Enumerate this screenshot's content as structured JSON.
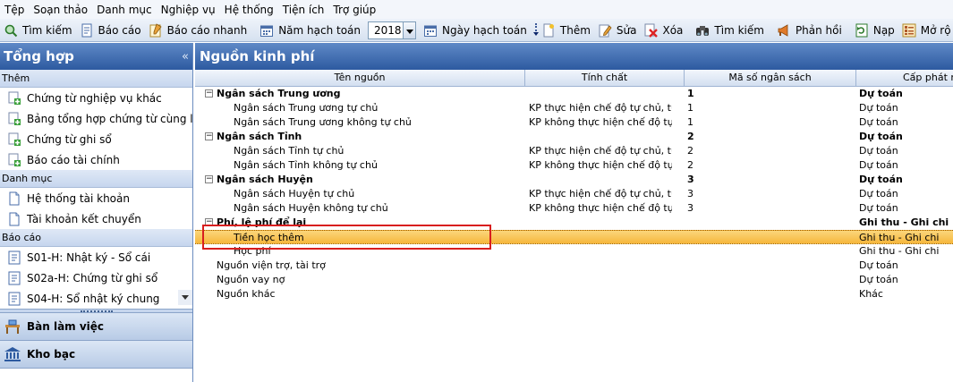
{
  "menu": [
    "Tệp",
    "Soạn thảo",
    "Danh mục",
    "Nghiệp vụ",
    "Hệ thống",
    "Tiện ích",
    "Trợ giúp"
  ],
  "toolbar": {
    "search": "Tìm kiếm",
    "report": "Báo cáo",
    "quick_report": "Báo cáo nhanh",
    "fiscal_year_label": "Năm hạch toán",
    "fiscal_year_value": "2018",
    "posting_date": "Ngày hạch toán",
    "add": "Thêm",
    "edit": "Sửa",
    "delete": "Xóa",
    "search2": "Tìm kiếm",
    "feedback": "Phản hồi",
    "load": "Nạp",
    "open": "Mở rộ"
  },
  "left": {
    "title": "Tổng hợp",
    "collapse": "«",
    "groups": [
      {
        "label": "Thêm",
        "items": [
          "Chứng từ nghiệp vụ khác",
          "Bảng tổng hợp chứng từ cùng loại",
          "Chứng từ ghi sổ",
          "Báo cáo tài chính"
        ]
      },
      {
        "label": "Danh mục",
        "items": [
          "Hệ thống tài khoản",
          "Tài khoản kết chuyển"
        ]
      },
      {
        "label": "Báo cáo",
        "items": [
          "S01-H: Nhật ký - Sổ cái",
          "S02a-H: Chứng từ ghi sổ",
          "S04-H: Sổ nhật ký chung"
        ]
      }
    ],
    "nav": [
      "Bàn làm việc",
      "Kho bạc"
    ]
  },
  "right": {
    "title": "Nguồn kinh phí",
    "columns": [
      "Tên nguồn",
      "Tính chất",
      "Mã số ngân sách",
      "Cấp phát n"
    ],
    "rows": [
      {
        "name": "Ngân sách Trung ương",
        "nature": "",
        "code": "1",
        "alloc": "Dự toán",
        "level": 0,
        "bold": true,
        "group": true
      },
      {
        "name": "Ngân sách Trung ương tự chủ",
        "nature": "KP thực hiện chế độ tự chủ, tự...",
        "code": "1",
        "alloc": "Dự toán",
        "level": 1
      },
      {
        "name": "Ngân sách Trung ương không tự chủ",
        "nature": "KP không thực hiện chế độ tự...",
        "code": "1",
        "alloc": "Dự toán",
        "level": 1
      },
      {
        "name": "Ngân sách Tỉnh",
        "nature": "",
        "code": "2",
        "alloc": "Dự toán",
        "level": 0,
        "bold": true,
        "group": true
      },
      {
        "name": "Ngân sách Tỉnh tự chủ",
        "nature": "KP thực hiện chế độ tự chủ, tự...",
        "code": "2",
        "alloc": "Dự toán",
        "level": 1
      },
      {
        "name": "Ngân sách Tỉnh không tự chủ",
        "nature": "KP không thực hiện chế độ tự...",
        "code": "2",
        "alloc": "Dự toán",
        "level": 1
      },
      {
        "name": "Ngân sách Huyện",
        "nature": "",
        "code": "3",
        "alloc": "Dự toán",
        "level": 0,
        "bold": true,
        "group": true
      },
      {
        "name": "Ngân sách Huyện tự chủ",
        "nature": "KP thực hiện chế độ tự chủ, tự...",
        "code": "3",
        "alloc": "Dự toán",
        "level": 1
      },
      {
        "name": "Ngân sách Huyện không tự chủ",
        "nature": "KP không thực hiện chế độ tự...",
        "code": "3",
        "alloc": "Dự toán",
        "level": 1
      },
      {
        "name": "Phí, lệ phí để lại",
        "nature": "",
        "code": "",
        "alloc": "Ghi thu - Ghi chi",
        "level": 0,
        "bold": true,
        "group": true
      },
      {
        "name": "Tiền học thêm",
        "nature": "",
        "code": "",
        "alloc": "Ghi thu - Ghi chi",
        "level": 1,
        "selected": true
      },
      {
        "name": "Học phí",
        "nature": "",
        "code": "",
        "alloc": "Ghi thu - Ghi chi",
        "level": 1
      },
      {
        "name": "Nguồn viện trợ, tài trợ",
        "nature": "",
        "code": "",
        "alloc": "Dự toán",
        "level": 0
      },
      {
        "name": "Nguồn vay nợ",
        "nature": "",
        "code": "",
        "alloc": "Dự toán",
        "level": 0
      },
      {
        "name": "Nguồn khác",
        "nature": "",
        "code": "",
        "alloc": "Khác",
        "level": 0
      }
    ]
  },
  "colors": {
    "header_blue": "#2d5aa0",
    "selection_orange": "#f6b73c",
    "highlight_red": "#d81e1e"
  }
}
